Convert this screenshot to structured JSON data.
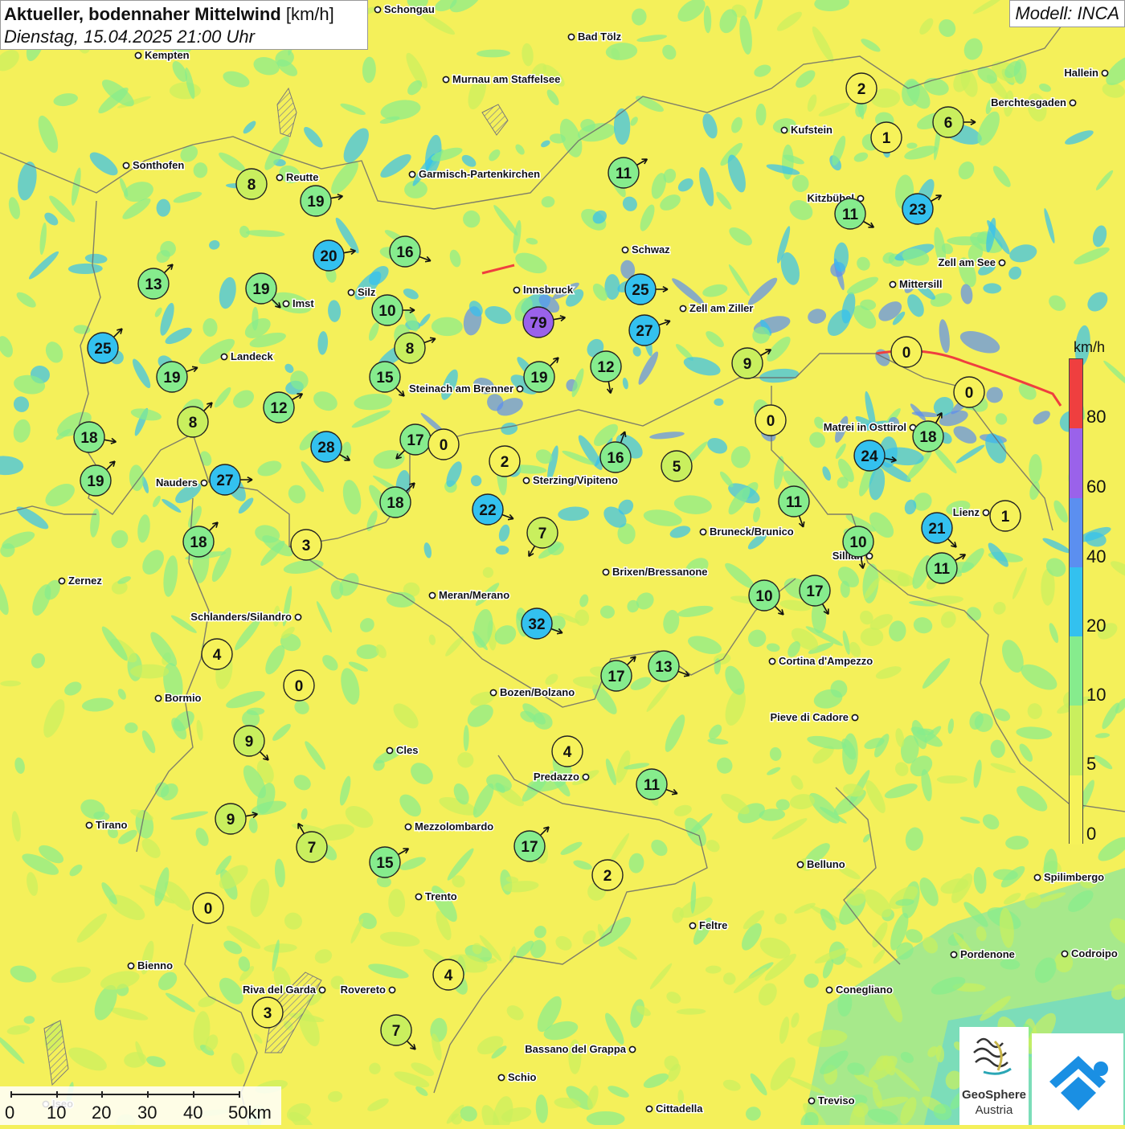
{
  "header": {
    "title": "Aktueller, bodennaher Mittelwind",
    "unit": "[km/h]",
    "subtitle": "Dienstag, 15.04.2025 21:00 Uhr",
    "model": "Modell: INCA"
  },
  "legend": {
    "unit": "km/h",
    "ticks": [
      "0",
      "5",
      "10",
      "20",
      "40",
      "60",
      "80"
    ],
    "colors": [
      "#f6f25a",
      "#c9ef5e",
      "#86ec8d",
      "#33c1ef",
      "#5b8ff0",
      "#9a62ea",
      "#ef3f3f"
    ]
  },
  "scale": {
    "labels": [
      "0",
      "10",
      "20",
      "30",
      "40",
      "50km"
    ]
  },
  "logos": {
    "geosphere_line1": "GeoSphere",
    "geosphere_line2": "Austria",
    "geosphere_icon": "geosphere-icon",
    "app_icon": "wetter-app-icon"
  },
  "cities": [
    {
      "name": "Kempten"
    },
    {
      "name": "Bad Tölz"
    },
    {
      "name": "Murnau am Staffelsee"
    },
    {
      "name": "Hallein"
    },
    {
      "name": "Berchtesgaden"
    },
    {
      "name": "Kufstein"
    },
    {
      "name": "Sonthofen"
    },
    {
      "name": "Reutte"
    },
    {
      "name": "Garmisch-Partenkirchen"
    },
    {
      "name": "Kitzbühel"
    },
    {
      "name": "Schwaz"
    },
    {
      "name": "Zell am See"
    },
    {
      "name": "Innsbruck"
    },
    {
      "name": "Mittersill"
    },
    {
      "name": "Silz"
    },
    {
      "name": "Imst"
    },
    {
      "name": "Zell am Ziller"
    },
    {
      "name": "Landeck"
    },
    {
      "name": "Steinach am Brenner"
    },
    {
      "name": "Matrei in Osttirol"
    },
    {
      "name": "Nauders"
    },
    {
      "name": "Sterzing/Vipiteno"
    },
    {
      "name": "Lienz"
    },
    {
      "name": "Bruneck/Brunico"
    },
    {
      "name": "Sillian"
    },
    {
      "name": "Zernez"
    },
    {
      "name": "Brixen/Bressanone"
    },
    {
      "name": "Meran/Merano"
    },
    {
      "name": "Schlanders/Silandro"
    },
    {
      "name": "Cortina d'Ampezzo"
    },
    {
      "name": "Bormio"
    },
    {
      "name": "Bozen/Bolzano"
    },
    {
      "name": "Pieve di Cadore"
    },
    {
      "name": "Cles"
    },
    {
      "name": "Predazzo"
    },
    {
      "name": "Tirano"
    },
    {
      "name": "Mezzolombardo"
    },
    {
      "name": "Belluno"
    },
    {
      "name": "Spilimbergo"
    },
    {
      "name": "Trento"
    },
    {
      "name": "Feltre"
    },
    {
      "name": "Pordenone"
    },
    {
      "name": "Codroipo"
    },
    {
      "name": "Bienno"
    },
    {
      "name": "Riva del Garda"
    },
    {
      "name": "Rovereto"
    },
    {
      "name": "Conegliano"
    },
    {
      "name": "Bassano del Grappa"
    },
    {
      "name": "Schio"
    },
    {
      "name": "Treviso"
    },
    {
      "name": "Cittadella"
    },
    {
      "name": "Iseo"
    },
    {
      "name": "Schongau"
    }
  ],
  "stations": [
    {
      "v": "2",
      "bearing": null
    },
    {
      "v": "1",
      "bearing": null
    },
    {
      "v": "6",
      "bearing": 90
    },
    {
      "v": "8",
      "bearing": null
    },
    {
      "v": "19",
      "bearing": 80
    },
    {
      "v": "11",
      "bearing": 60
    },
    {
      "v": "11",
      "bearing": 120
    },
    {
      "v": "23",
      "bearing": 60
    },
    {
      "v": "20",
      "bearing": 80
    },
    {
      "v": "16",
      "bearing": 110
    },
    {
      "v": "13",
      "bearing": 45
    },
    {
      "v": "19",
      "bearing": 135
    },
    {
      "v": "25",
      "bearing": 90
    },
    {
      "v": "10",
      "bearing": 90
    },
    {
      "v": "79",
      "bearing": 80
    },
    {
      "v": "27",
      "bearing": 70
    },
    {
      "v": "25",
      "bearing": 45
    },
    {
      "v": "0",
      "bearing": null
    },
    {
      "v": "19",
      "bearing": 70
    },
    {
      "v": "8",
      "bearing": 70
    },
    {
      "v": "9",
      "bearing": 60
    },
    {
      "v": "15",
      "bearing": 135
    },
    {
      "v": "19",
      "bearing": 45
    },
    {
      "v": "12",
      "bearing": 170
    },
    {
      "v": "0",
      "bearing": null
    },
    {
      "v": "8",
      "bearing": 45
    },
    {
      "v": "12",
      "bearing": 60
    },
    {
      "v": "0",
      "bearing": null
    },
    {
      "v": "18",
      "bearing": 100
    },
    {
      "v": "28",
      "bearing": 120
    },
    {
      "v": "17",
      "bearing": 225
    },
    {
      "v": "0",
      "bearing": null
    },
    {
      "v": "18",
      "bearing": 45
    },
    {
      "v": "16",
      "bearing": 20
    },
    {
      "v": "5",
      "bearing": null
    },
    {
      "v": "2",
      "bearing": null
    },
    {
      "v": "19",
      "bearing": 45
    },
    {
      "v": "27",
      "bearing": 90
    },
    {
      "v": "24",
      "bearing": 100
    },
    {
      "v": "18",
      "bearing": 30
    },
    {
      "v": "22",
      "bearing": 110
    },
    {
      "v": "11",
      "bearing": 160
    },
    {
      "v": "21",
      "bearing": 135
    },
    {
      "v": "1",
      "bearing": null
    },
    {
      "v": "7",
      "bearing": 210
    },
    {
      "v": "18",
      "bearing": 45
    },
    {
      "v": "3",
      "bearing": null
    },
    {
      "v": "10",
      "bearing": 170
    },
    {
      "v": "11",
      "bearing": 60
    },
    {
      "v": "10",
      "bearing": 135
    },
    {
      "v": "17",
      "bearing": 150
    },
    {
      "v": "32",
      "bearing": 110
    },
    {
      "v": "4",
      "bearing": null
    },
    {
      "v": "0",
      "bearing": null
    },
    {
      "v": "17",
      "bearing": 45
    },
    {
      "v": "13",
      "bearing": 110
    },
    {
      "v": "9",
      "bearing": 135
    },
    {
      "v": "4",
      "bearing": null
    },
    {
      "v": "11",
      "bearing": 110
    },
    {
      "v": "9",
      "bearing": 80
    },
    {
      "v": "7",
      "bearing": 330
    },
    {
      "v": "17",
      "bearing": 45
    },
    {
      "v": "15",
      "bearing": 60
    },
    {
      "v": "2",
      "bearing": null
    },
    {
      "v": "0",
      "bearing": null
    },
    {
      "v": "4",
      "bearing": null
    },
    {
      "v": "3",
      "bearing": null
    },
    {
      "v": "7",
      "bearing": 135
    }
  ]
}
